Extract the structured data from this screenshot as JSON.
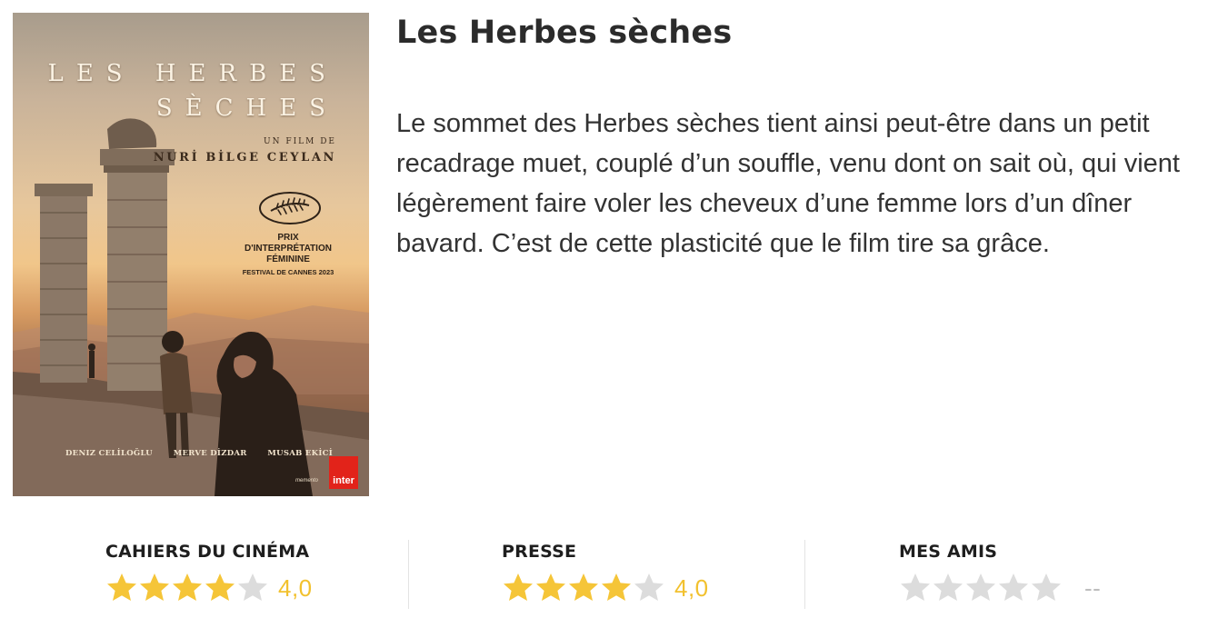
{
  "poster": {
    "title_line1": "LES HERBES",
    "title_line2": "SÈCHES",
    "film_by": "UN FILM DE",
    "director": "NURİ BİLGE CEYLAN",
    "award_line1": "PRIX",
    "award_line2": "D'INTERPRÉTATION",
    "award_line3": "FÉMININE",
    "award_festival": "FESTIVAL DE CANNES 2023",
    "cast": [
      "DENIZ CELİLOĞLU",
      "MERVE DİZDAR",
      "MUSAB EKİCİ"
    ],
    "radio_logo": "inter",
    "distributor": "memento",
    "cannes_logo_icon": "palme-dor-icon"
  },
  "film": {
    "title": "Les Herbes sèches",
    "synopsis": "Le sommet des Herbes sèches tient ainsi peut-être dans un petit recadrage muet, couplé d’un souffle, venu dont on sait où, qui vient légèrement faire voler les cheveux d’une femme lors d’un dîner bavard. C’est de cette plasticité que le film tire sa grâce."
  },
  "ratings": [
    {
      "label": "CAHIERS DU CINÉMA",
      "stars": 4,
      "max": 5,
      "score": "4,0"
    },
    {
      "label": "PRESSE",
      "stars": 4,
      "max": 5,
      "score": "4,0"
    },
    {
      "label": "MES AMIS",
      "stars": 0,
      "max": 5,
      "score": "--"
    }
  ],
  "colors": {
    "star_filled": "#f5c538",
    "star_empty": "#dcdcdc",
    "score": "#f2c12e",
    "score_empty": "#bdbdbd",
    "divider": "#e3e3e3"
  }
}
